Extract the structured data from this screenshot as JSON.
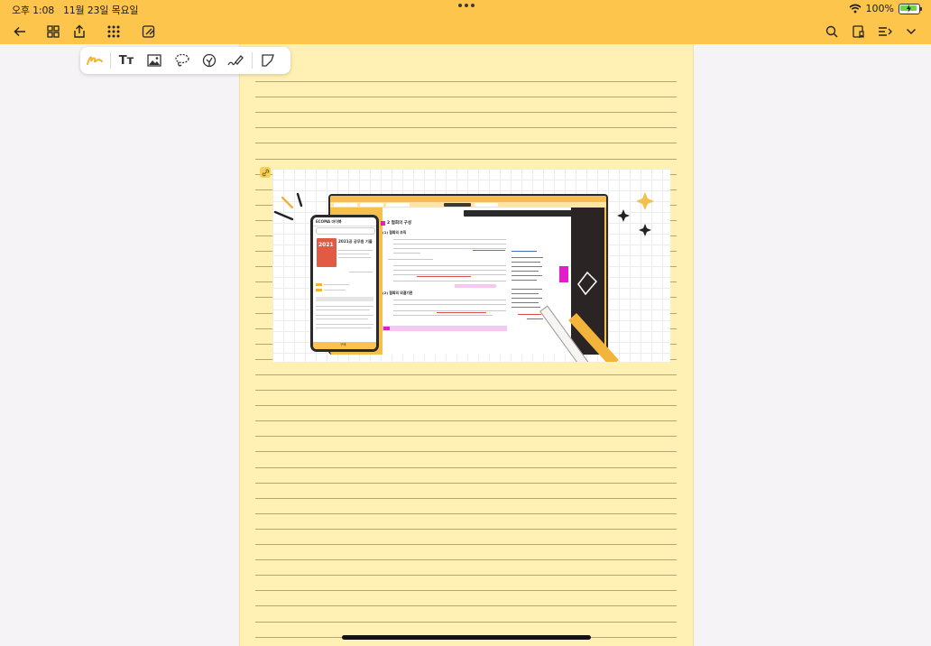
{
  "status_bar": {
    "time": "오후 1:08",
    "date": "11월 23일 목요일",
    "battery_percent": "100%",
    "battery_level": 1.0
  },
  "toolbar": {
    "left_icons": [
      "back-arrow-icon",
      "grid-view-icon",
      "export-icon",
      "apps-icon",
      "reading-mode-icon"
    ],
    "right_icons": [
      "search-icon",
      "bookmark-icon",
      "page-list-icon",
      "chevron-down-icon"
    ]
  },
  "pen_tools": {
    "items": [
      "pen-icon",
      "text-icon",
      "image-icon",
      "lasso-icon",
      "sticker-icon",
      "highlighter-icon",
      "shape-crop-icon"
    ],
    "selected": "pen-icon",
    "text_tool_glyph": "Tт"
  },
  "pasted_image": {
    "phone": {
      "brand": "ECOMA 마이북",
      "book_cover_year": "2021",
      "book_title": "2021공 공무원 기출",
      "footer": "구매"
    },
    "tablet": {
      "section_heading": "2 협회의 구성",
      "subheading_1": "(1) 협회의 조직",
      "subheading_2": "(2) 협회의 의결기관"
    }
  },
  "colors": {
    "accent": "#fdc54c",
    "page": "#fff0b4",
    "rule": "#a08d5b",
    "canvas": "#f6f3f6"
  }
}
